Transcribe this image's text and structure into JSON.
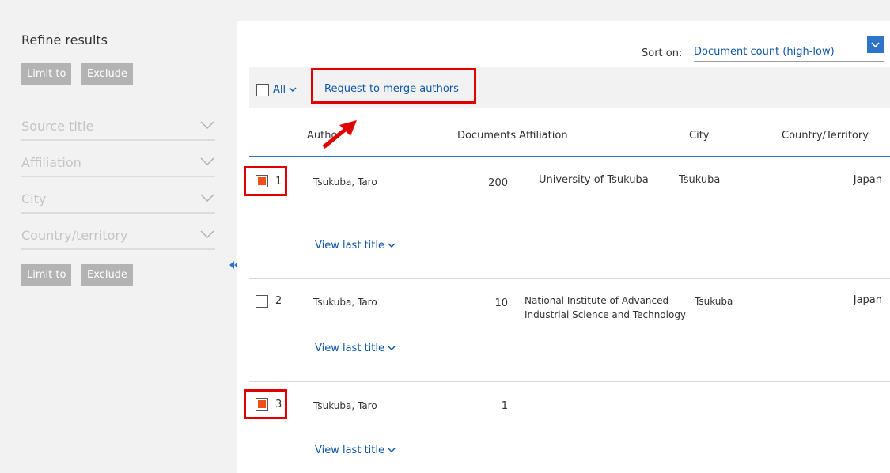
{
  "sidebar": {
    "title": "Refine results",
    "limit_label": "Limit to",
    "exclude_label": "Exclude",
    "facets": [
      "Source title",
      "Affiliation",
      "City",
      "Country/territory"
    ]
  },
  "sort": {
    "label": "Sort on:",
    "value": "Document count (high-low)"
  },
  "toolbar": {
    "all_label": "All",
    "merge_label": "Request to merge authors"
  },
  "columns": {
    "author": "Author",
    "documents": "Documents",
    "affiliation": "Affiliation",
    "city": "City",
    "country": "Country/Territory"
  },
  "rows": [
    {
      "index": "1",
      "checked": true,
      "author": "Tsukuba, Taro",
      "documents": "200",
      "affiliation": "University of Tsukuba",
      "city": "Tsukuba",
      "country": "Japan",
      "view": "View last title"
    },
    {
      "index": "2",
      "checked": false,
      "author": "Tsukuba, Taro",
      "documents": "10",
      "affiliation": "National Institute of Advanced Industrial Science and Technology",
      "city": "Tsukuba",
      "country": "Japan",
      "view": "View last title"
    },
    {
      "index": "3",
      "checked": true,
      "author": "Tsukuba, Taro",
      "documents": "1",
      "affiliation": "",
      "city": "",
      "country": "",
      "view": "View last title"
    }
  ],
  "colors": {
    "link": "#0f57a8",
    "highlight": "#e00000",
    "checked_fill": "#ee4f1b",
    "header_rule": "#2e74c9"
  }
}
